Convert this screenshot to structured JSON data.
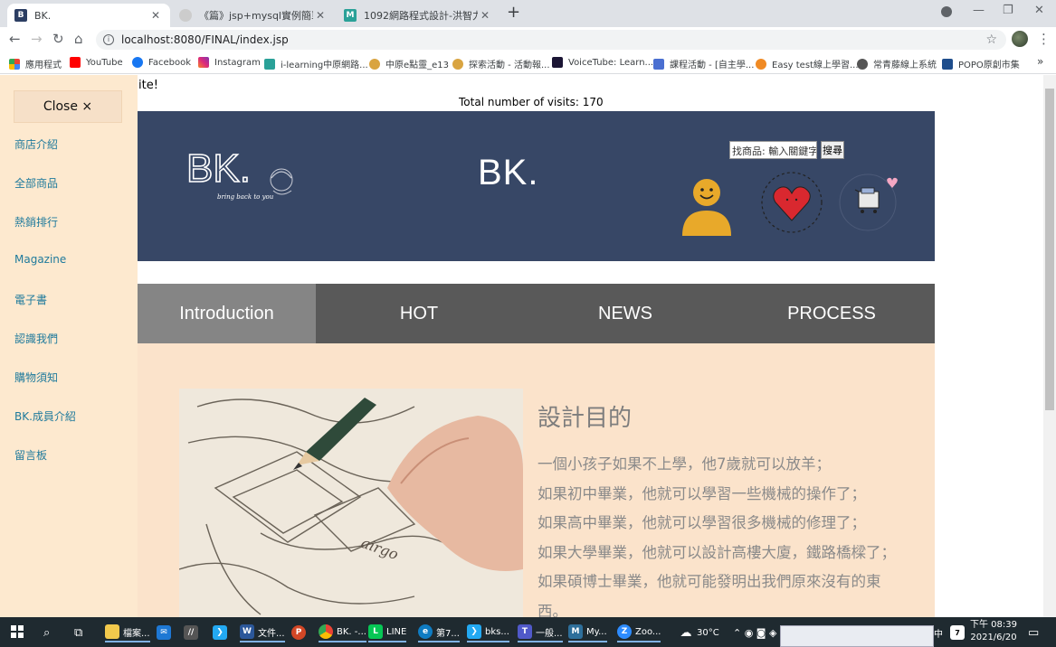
{
  "browser": {
    "tabs": [
      {
        "title": "BK.",
        "active": true
      },
      {
        "title": "《篇》jsp+mysql實例簡單的購",
        "active": false
      },
      {
        "title": "1092網路程式設計-洪智力 - i-lear",
        "active": false
      }
    ],
    "new_tab": "+",
    "url": "localhost:8080/FINAL/index.jsp",
    "bookmarks": [
      {
        "label": "應用程式",
        "icon": "apps-grid-icon"
      },
      {
        "label": "YouTube",
        "icon": "youtube-icon"
      },
      {
        "label": "Facebook",
        "icon": "facebook-icon"
      },
      {
        "label": "Instagram",
        "icon": "instagram-icon"
      },
      {
        "label": "i-learning中原網路...",
        "icon": "ilearning-icon"
      },
      {
        "label": "中原e點靈_e13",
        "icon": "owl-icon"
      },
      {
        "label": "探索活動 - 活動報...",
        "icon": "owl-icon"
      },
      {
        "label": "VoiceTube: Learn...",
        "icon": "voicetube-icon"
      },
      {
        "label": "課程活動 - [自主學...",
        "icon": "course-icon"
      },
      {
        "label": "Easy test線上學習...",
        "icon": "easytest-icon"
      },
      {
        "label": "常青藤線上系統",
        "icon": "globe-icon"
      },
      {
        "label": "POPO原創市集",
        "icon": "popo-icon"
      }
    ],
    "bookmarks_more": "»"
  },
  "page": {
    "marquee_text": "ite!",
    "visits_text": "Total number of visits: 170",
    "sidenav": {
      "close_label": "Close ×",
      "items": [
        "商店介紹",
        "全部商品",
        "熱銷排行",
        "Magazine",
        "電子書",
        "認識我們",
        "購物須知",
        "BK.成員介紹",
        "留言板"
      ]
    },
    "header": {
      "logo_text": "BK.",
      "logo_tagline": "bring back to you",
      "title": "BK.",
      "search_placeholder": "找商品: 輸入關鍵字",
      "search_button": "搜尋"
    },
    "menu": {
      "tabs": [
        "Introduction",
        "HOT",
        "NEWS",
        "PROCESS"
      ],
      "active_index": 0
    },
    "content": {
      "heading": "設計目的",
      "lines": [
        "一個小孩子如果不上學，他7歲就可以放羊；",
        "如果初中畢業，他就可以學習一些機械的操作了；",
        "如果高中畢業，他就可以學習很多機械的修理了；",
        "如果大學畢業，他就可以設計高樓大廈，鐵路橋樑了；",
        "如果碩博士畢業，他就可能發明出我們原來沒有的東",
        "西。"
      ]
    }
  },
  "taskbar": {
    "items": [
      {
        "label": "檔案...",
        "icon": "file-explorer-icon"
      },
      {
        "label": "",
        "icon": "mail-icon"
      },
      {
        "label": "",
        "icon": "ide-icon"
      },
      {
        "label": "",
        "icon": "vscode-icon"
      },
      {
        "label": "文件...",
        "icon": "word-icon"
      },
      {
        "label": "",
        "icon": "powerpoint-icon"
      },
      {
        "label": "BK. -...",
        "icon": "chrome-icon"
      },
      {
        "label": "LINE",
        "icon": "line-icon"
      },
      {
        "label": "第7...",
        "icon": "edge-icon"
      },
      {
        "label": "bks...",
        "icon": "vscode-icon"
      },
      {
        "label": "一般...",
        "icon": "teams-icon"
      },
      {
        "label": "My...",
        "icon": "mysql-icon"
      },
      {
        "label": "Zoo...",
        "icon": "zoom-icon"
      }
    ],
    "weather": "30°C",
    "ime": "中",
    "time": "下午 08:39",
    "date": "2021/6/20"
  },
  "colors": {
    "header_bg": "#374766",
    "menu_bg": "#595959",
    "menu_active": "#858585",
    "sidenav_bg": "#fde9cf",
    "content_bg": "#fbe3cb",
    "nav_link": "#1f7a9c"
  }
}
